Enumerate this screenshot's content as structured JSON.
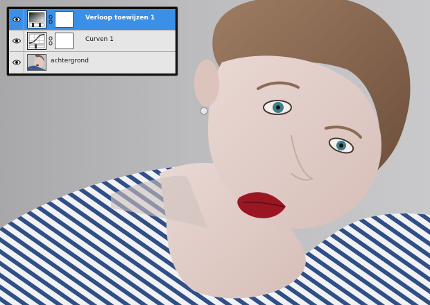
{
  "layers_panel": {
    "layers": [
      {
        "name": "Verloop toewijzen 1",
        "type": "gradient-map-adjustment",
        "selected": true,
        "visible": true
      },
      {
        "name": "Curven 1",
        "type": "curves-adjustment",
        "selected": false,
        "visible": true
      },
      {
        "name": "achtergrond",
        "type": "background",
        "selected": false,
        "visible": true
      }
    ]
  },
  "colors": {
    "selected_row": "#3b8fe6",
    "panel_bg": "#e3e3e3",
    "lip_red": "#9a1622"
  }
}
